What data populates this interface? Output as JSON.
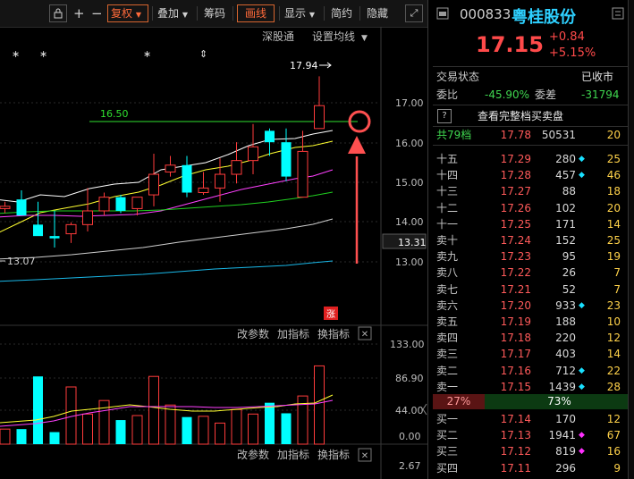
{
  "toolbar": {
    "restore_label": "复权",
    "overlay_label": "叠加",
    "chips_label": "筹码",
    "draw_label": "画线",
    "display_label": "显示",
    "simple_label": "简约",
    "hide_label": "隐藏"
  },
  "chart_labels": {
    "connect_label": "深股通",
    "ma_setting_label": "设置均线",
    "high_label": "17.94",
    "line_label": "16.50",
    "low_label": "13.07",
    "limit_badge": "涨",
    "y_ticks": [
      "17.00",
      "16.00",
      "15.00",
      "14.00",
      "13.00"
    ],
    "current_tag": "13.31",
    "sub_y_ticks": [
      "133.00",
      "86.90",
      "44.00",
      "0.00"
    ],
    "bottom_tick": "2.67",
    "change_param_label": "改参数",
    "add_indicator_label": "加指标",
    "swap_indicator_label": "换指标",
    "close_label": "✕",
    "marker_star": "∗",
    "marker_updown": "⇕"
  },
  "chart_data": {
    "type": "candlestick",
    "up_color": "#ff3b3b",
    "down_color": "#00ffff",
    "candles": [
      {
        "open": 15.05,
        "high": 15.2,
        "low": 14.95,
        "close": 15.1
      },
      {
        "open": 15.25,
        "high": 15.45,
        "low": 14.95,
        "close": 14.9
      },
      {
        "open": 14.7,
        "high": 15.2,
        "low": 14.5,
        "close": 14.45
      },
      {
        "open": 14.45,
        "high": 15.0,
        "low": 14.2,
        "close": 14.4
      },
      {
        "open": 14.5,
        "high": 14.75,
        "low": 14.3,
        "close": 14.7
      },
      {
        "open": 14.7,
        "high": 15.5,
        "low": 14.55,
        "close": 15.0
      },
      {
        "open": 15.0,
        "high": 15.4,
        "low": 14.9,
        "close": 15.3
      },
      {
        "open": 15.3,
        "high": 15.35,
        "low": 14.95,
        "close": 15.0
      },
      {
        "open": 15.05,
        "high": 15.3,
        "low": 14.9,
        "close": 15.3
      },
      {
        "open": 15.35,
        "high": 16.25,
        "low": 15.1,
        "close": 15.8
      },
      {
        "open": 15.85,
        "high": 16.2,
        "low": 15.75,
        "close": 16.0
      },
      {
        "open": 16.0,
        "high": 16.2,
        "low": 15.3,
        "close": 15.4
      },
      {
        "open": 15.4,
        "high": 15.85,
        "low": 15.35,
        "close": 15.5
      },
      {
        "open": 15.5,
        "high": 16.15,
        "low": 15.2,
        "close": 15.8
      },
      {
        "open": 15.8,
        "high": 16.5,
        "low": 15.6,
        "close": 16.1
      },
      {
        "open": 16.1,
        "high": 16.9,
        "low": 15.8,
        "close": 16.4
      },
      {
        "open": 16.75,
        "high": 16.8,
        "low": 16.2,
        "close": 16.5
      },
      {
        "open": 16.5,
        "high": 16.8,
        "low": 15.65,
        "close": 15.75
      },
      {
        "open": 15.3,
        "high": 16.75,
        "low": 15.3,
        "close": 16.3
      },
      {
        "open": 16.8,
        "high": 17.94,
        "low": 16.8,
        "close": 17.3
      }
    ],
    "volume": [
      {
        "value": 20,
        "up": true
      },
      {
        "value": 20,
        "up": false
      },
      {
        "value": 90,
        "up": false
      },
      {
        "value": 16,
        "up": false
      },
      {
        "value": 76,
        "up": true
      },
      {
        "value": 40,
        "up": true
      },
      {
        "value": 58,
        "up": true
      },
      {
        "value": 32,
        "up": false
      },
      {
        "value": 38,
        "up": true
      },
      {
        "value": 90,
        "up": true
      },
      {
        "value": 52,
        "up": true
      },
      {
        "value": 36,
        "up": false
      },
      {
        "value": 37,
        "up": true
      },
      {
        "value": 28,
        "up": true
      },
      {
        "value": 46,
        "up": true
      },
      {
        "value": 40,
        "up": true
      },
      {
        "value": 55,
        "up": false
      },
      {
        "value": 41,
        "up": false
      },
      {
        "value": 64,
        "up": true
      },
      {
        "value": 104,
        "up": true
      }
    ],
    "ylim": [
      12.5,
      18.3
    ],
    "volume_ylim": [
      0,
      133
    ]
  },
  "stock": {
    "code": "000833",
    "name": "粤桂股份",
    "price": "17.15",
    "change": "+0.84",
    "change_pct": "+5.15%",
    "status_label": "交易状态",
    "status_value": "已收市",
    "ratio_label": "委比",
    "ratio_value": "-45.90%",
    "diff_label": "委差",
    "diff_value": "-31794",
    "full_book_label": "查看完整档买卖盘",
    "help_icon": "?",
    "levels_label": "共79档",
    "levels_price": "17.78",
    "levels_vol": "50531",
    "levels_cnt": "20",
    "bar_sell_pct": "27%",
    "bar_buy_pct": "73%"
  },
  "sell_orders": [
    {
      "label": "十五",
      "price": "17.29",
      "vol": "280",
      "dot": "cyan",
      "cnt": "25"
    },
    {
      "label": "十四",
      "price": "17.28",
      "vol": "457",
      "dot": "cyan",
      "cnt": "46"
    },
    {
      "label": "十三",
      "price": "17.27",
      "vol": "88",
      "dot": "",
      "cnt": "18"
    },
    {
      "label": "十二",
      "price": "17.26",
      "vol": "102",
      "dot": "",
      "cnt": "20"
    },
    {
      "label": "十一",
      "price": "17.25",
      "vol": "171",
      "dot": "",
      "cnt": "14"
    },
    {
      "label": "卖十",
      "price": "17.24",
      "vol": "152",
      "dot": "",
      "cnt": "25"
    },
    {
      "label": "卖九",
      "price": "17.23",
      "vol": "95",
      "dot": "",
      "cnt": "19"
    },
    {
      "label": "卖八",
      "price": "17.22",
      "vol": "26",
      "dot": "",
      "cnt": "7"
    },
    {
      "label": "卖七",
      "price": "17.21",
      "vol": "52",
      "dot": "",
      "cnt": "7"
    },
    {
      "label": "卖六",
      "price": "17.20",
      "vol": "933",
      "dot": "cyan",
      "cnt": "23"
    },
    {
      "label": "卖五",
      "price": "17.19",
      "vol": "188",
      "dot": "",
      "cnt": "10"
    },
    {
      "label": "卖四",
      "price": "17.18",
      "vol": "220",
      "dot": "",
      "cnt": "12"
    },
    {
      "label": "卖三",
      "price": "17.17",
      "vol": "403",
      "dot": "",
      "cnt": "14"
    },
    {
      "label": "卖二",
      "price": "17.16",
      "vol": "712",
      "dot": "cyan",
      "cnt": "22"
    },
    {
      "label": "卖一",
      "price": "17.15",
      "vol": "1439",
      "dot": "cyan",
      "cnt": "28"
    }
  ],
  "buy_orders": [
    {
      "label": "买一",
      "price": "17.14",
      "vol": "170",
      "dot": "",
      "cnt": "12"
    },
    {
      "label": "买二",
      "price": "17.13",
      "vol": "1941",
      "dot": "magenta",
      "cnt": "67"
    },
    {
      "label": "买三",
      "price": "17.12",
      "vol": "819",
      "dot": "magenta",
      "cnt": "16"
    },
    {
      "label": "买四",
      "price": "17.11",
      "vol": "296",
      "dot": "",
      "cnt": "9"
    }
  ],
  "colors": {
    "up": "#ff3b3b",
    "down": "#00ffff",
    "highlight": "#ff6a3a",
    "annotation": "#ff5a5a"
  }
}
